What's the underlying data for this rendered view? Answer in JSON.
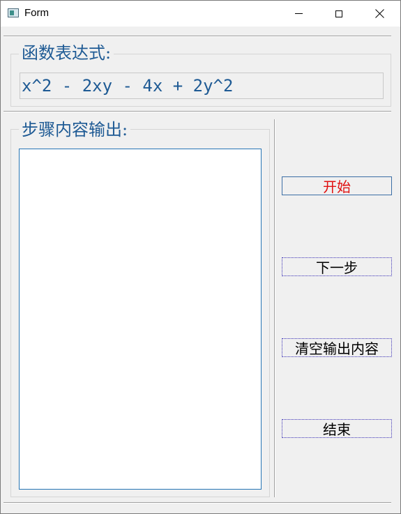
{
  "window": {
    "title": "Form",
    "icon": "app-window-icon"
  },
  "expression_group": {
    "title": "函数表达式:",
    "value": "x^2 - 2xy - 4x + 2y^2"
  },
  "steps_group": {
    "title": "步骤内容输出:",
    "output_text": ""
  },
  "buttons": {
    "start": "开始",
    "next": "下一步",
    "clear": "清空输出内容",
    "end": "结束"
  },
  "colors": {
    "accent_text": "#1e5a94",
    "start_text": "#e01010",
    "output_border": "#2675b5"
  }
}
